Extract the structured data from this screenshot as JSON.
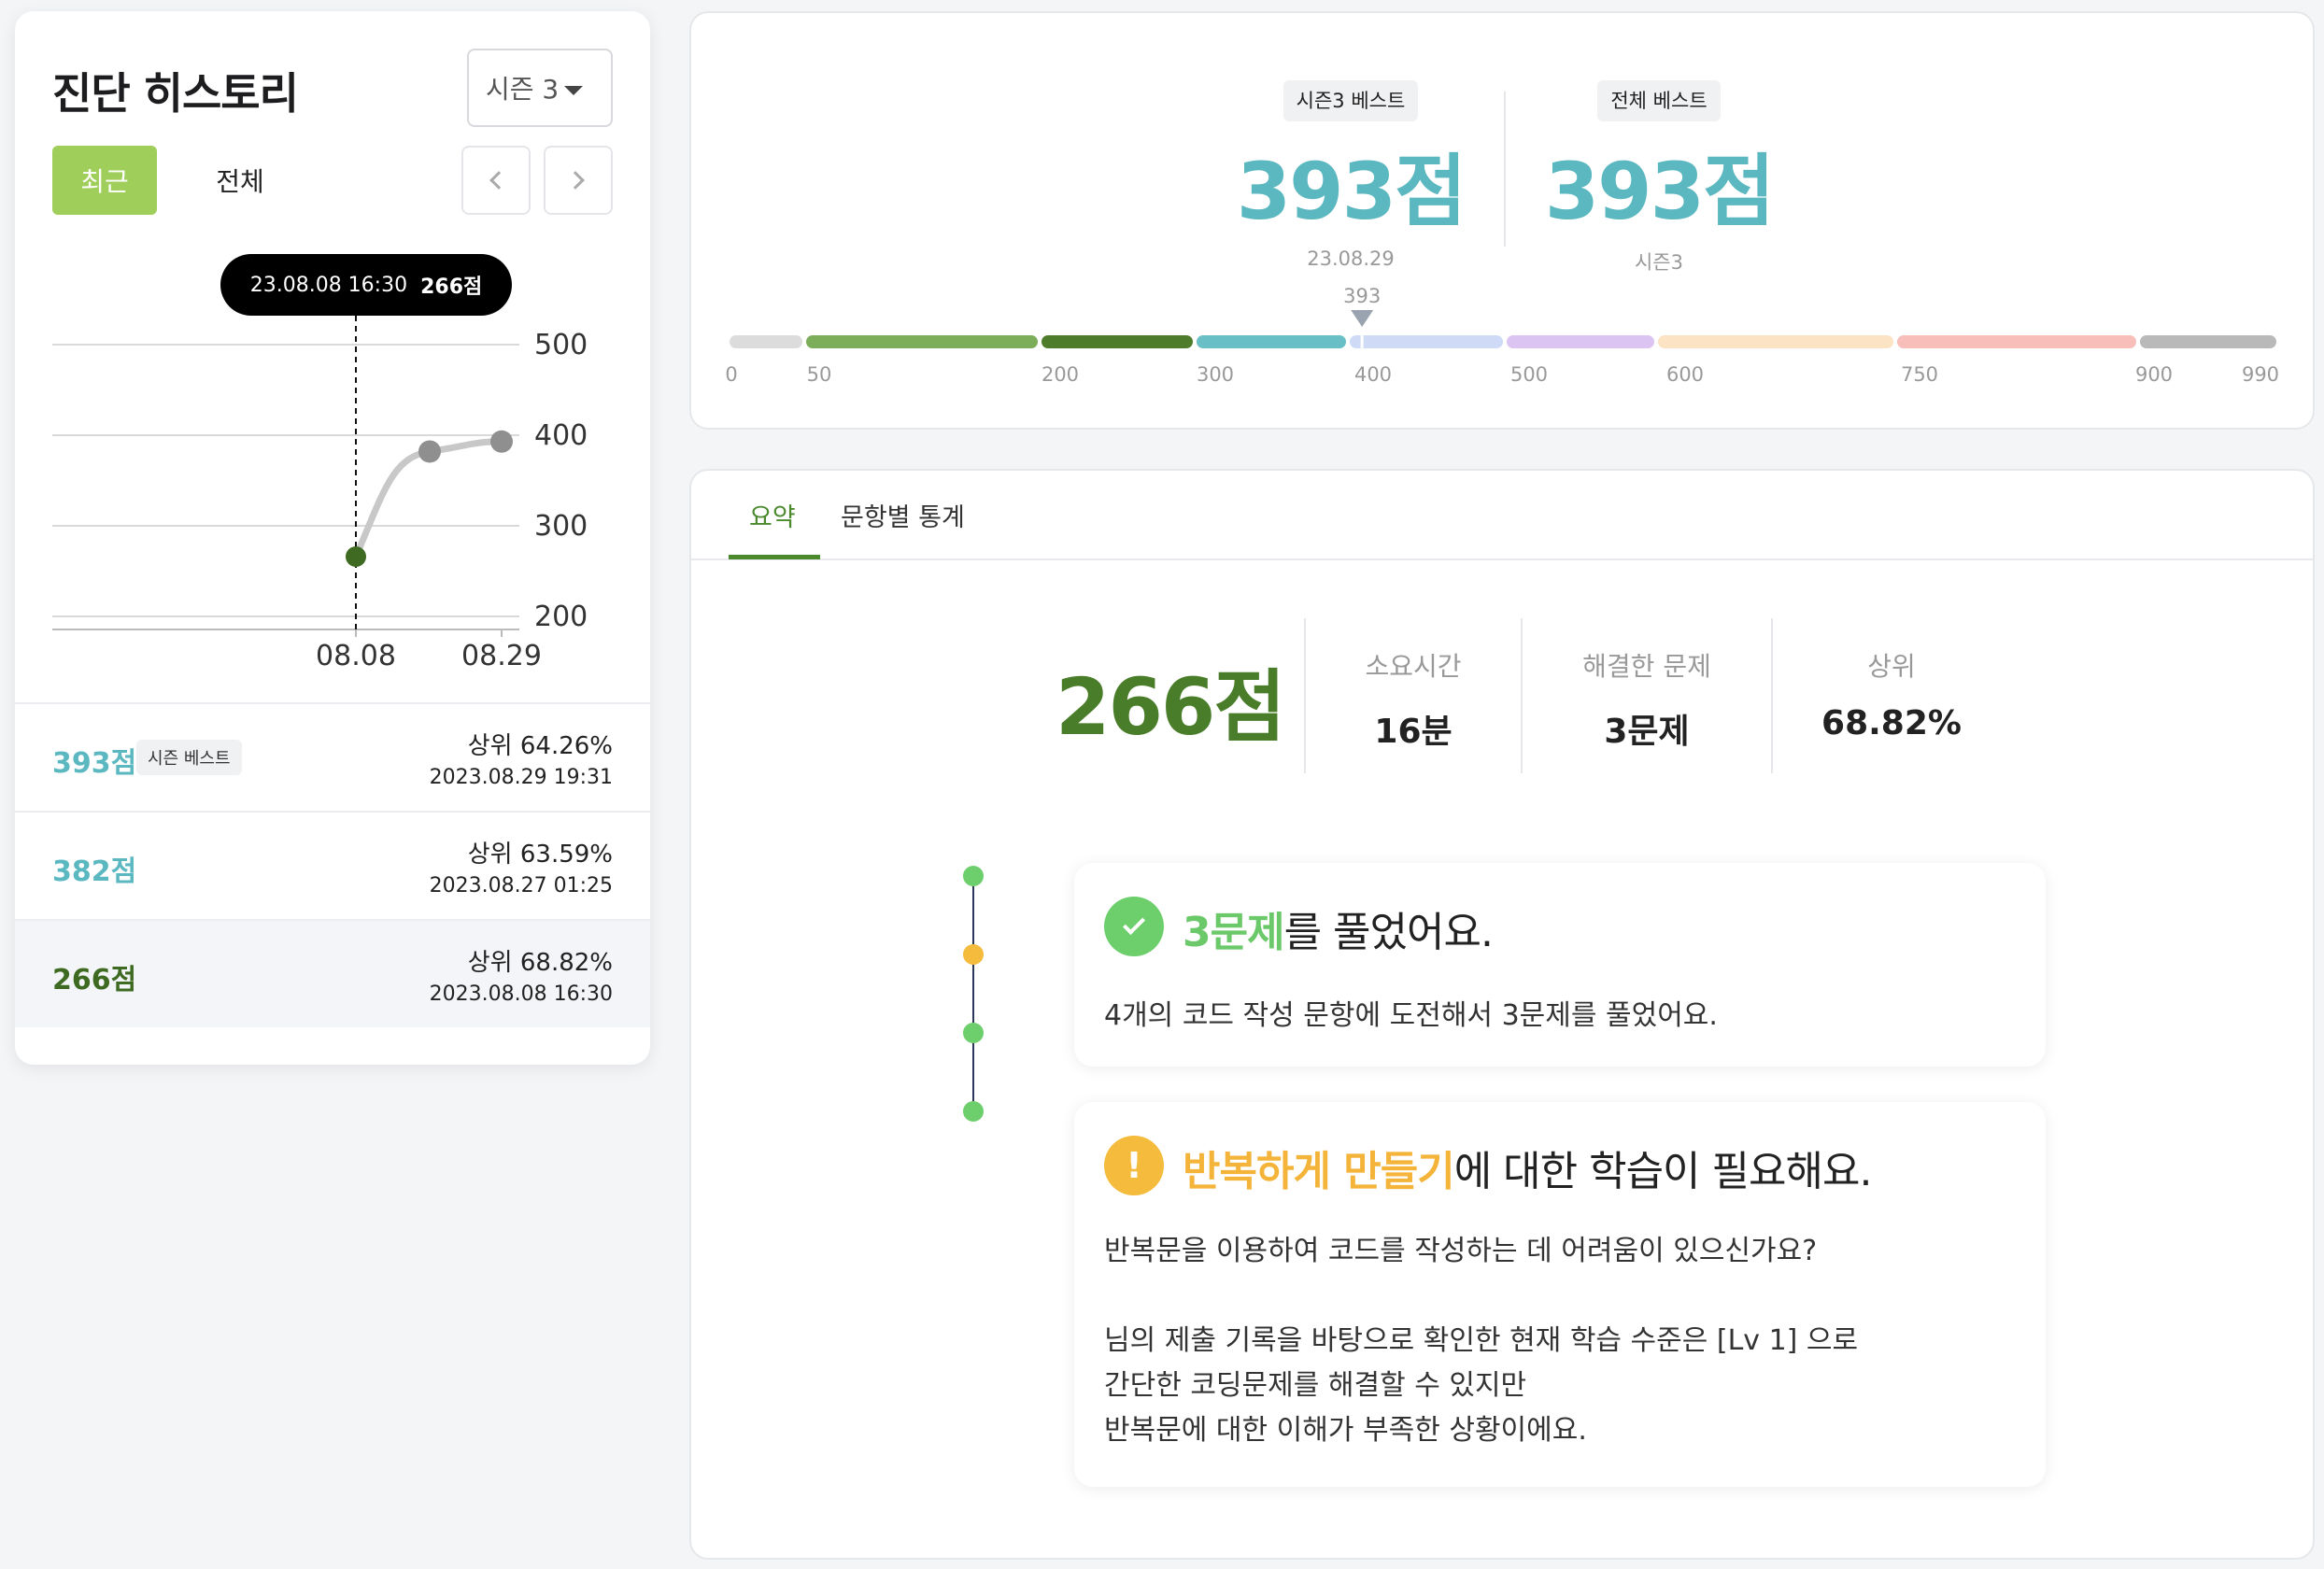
{
  "history": {
    "title": "진단 히스토리",
    "season_selected": "시즌 3",
    "filters": {
      "recent": "최근",
      "all": "전체"
    },
    "tooltip": {
      "datetime": "23.08.08 16:30",
      "score": "266점"
    },
    "chart_data": {
      "type": "line",
      "categories": [
        "08.08",
        "08.27",
        "08.29"
      ],
      "x_tick_labels": [
        "08.08",
        "08.29"
      ],
      "values": [
        266,
        382,
        393
      ],
      "highlight_index": 0,
      "ylim": [
        200,
        500
      ],
      "yticks": [
        "500",
        "400",
        "300",
        "200"
      ],
      "ytick_values": [
        500,
        400,
        300,
        200
      ],
      "grid": true,
      "colors": {
        "line": "#c8c8c8",
        "point": "#8f8f8f",
        "highlight": "#3e6b21"
      }
    },
    "items": [
      {
        "score": "393점",
        "badge": "시즌 베스트",
        "rank": "상위 64.26%",
        "date": "2023.08.29 19:31",
        "color": "#5bb8c0"
      },
      {
        "score": "382점",
        "badge": "",
        "rank": "상위 63.59%",
        "date": "2023.08.27 01:25",
        "color": "#5bb8c0"
      },
      {
        "score": "266점",
        "badge": "",
        "rank": "상위 68.82%",
        "date": "2023.08.08 16:30",
        "color": "#3e6b21"
      }
    ]
  },
  "best": {
    "season": {
      "tag": "시즌3 베스트",
      "score": "393점",
      "sub": "23.08.29"
    },
    "all": {
      "tag": "전체 베스트",
      "score": "393점",
      "sub": "시즌3"
    },
    "marker_value": "393",
    "marker_numeric": 393,
    "scale_ticks": [
      "0",
      "50",
      "200",
      "300",
      "400",
      "500",
      "600",
      "750",
      "900",
      "990"
    ],
    "scale_values": [
      0,
      50,
      200,
      300,
      400,
      500,
      600,
      750,
      900,
      990
    ],
    "segment_colors": [
      "#dcdcdc",
      "#7cad58",
      "#4d7d2b",
      "#68bfc6",
      "#cfdbf6",
      "#dcc4f2",
      "#fbe3c3",
      "#f8beb9",
      "#b9b9b9"
    ]
  },
  "detail": {
    "tabs": [
      "요약",
      "문항별 통계"
    ],
    "score": "266점",
    "stats": [
      {
        "label": "소요시간",
        "value": "16분"
      },
      {
        "label": "해결한 문제",
        "value": "3문제"
      },
      {
        "label": "상위",
        "value": "68.82%"
      }
    ],
    "timeline_dot_colors": [
      "#6ccf6c",
      "#f4bb3c",
      "#6ccf6c",
      "#6ccf6c"
    ],
    "card1": {
      "title_highlight": "3문제",
      "title_rest": "를 풀었어요.",
      "body": "4개의 코드 작성 문항에 도전해서 3문제를 풀었어요."
    },
    "card2": {
      "icon": "!",
      "title_highlight": "반복하게 만들기",
      "title_rest": "에 대한 학습이 필요해요.",
      "body_line1": "반복문을 이용하여 코드를 작성하는 데 어려움이 있으신가요?",
      "body_line2": "님의 제출 기록을 바탕으로 확인한 현재 학습 수준은 [Lv 1] 으로",
      "body_line3": "간단한 코딩문제를 해결할 수 있지만",
      "body_line4": "반복문에 대한 이해가 부족한 상황이에요."
    }
  }
}
